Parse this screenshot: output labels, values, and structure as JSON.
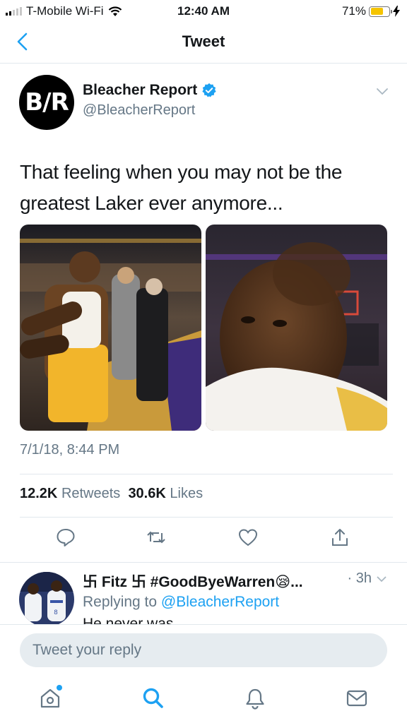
{
  "status_bar": {
    "carrier": "T-Mobile Wi-Fi",
    "time": "12:40 AM",
    "battery_percent": "71%",
    "battery_level": 0.71,
    "battery_color": "#f5c400"
  },
  "nav": {
    "title": "Tweet",
    "back_icon": "chevron-left-icon"
  },
  "tweet": {
    "avatar_text": "B/R",
    "author_name": "Bleacher Report",
    "verified": true,
    "author_handle": "@BleacherReport",
    "text": "That feeling when you may not be the greatest Laker ever anymore...",
    "timestamp": "7/1/18, 8:44 PM",
    "retweets_count": "12.2K",
    "retweets_label": "Retweets",
    "likes_count": "30.6K",
    "likes_label": "Likes",
    "photos": [
      {
        "icon": "photo-basketball-player-towel-courtside"
      },
      {
        "icon": "photo-basketball-player-closeup-towel"
      }
    ]
  },
  "actions": [
    {
      "name": "reply",
      "icon": "comment-icon"
    },
    {
      "name": "retweet",
      "icon": "retweet-icon"
    },
    {
      "name": "like",
      "icon": "heart-icon"
    },
    {
      "name": "share",
      "icon": "share-icon"
    }
  ],
  "reply": {
    "name": "卐 Fitz 卐 #GoodByeWarren😪...",
    "time": "· 3h",
    "replying_prefix": "Replying to",
    "replying_to": "@BleacherReport",
    "text": "He never was"
  },
  "compose": {
    "placeholder": "Tweet your reply"
  },
  "tabs": [
    {
      "name": "home",
      "icon": "home-icon",
      "has_dot": true
    },
    {
      "name": "search",
      "icon": "search-icon",
      "active": true
    },
    {
      "name": "notifications",
      "icon": "bell-icon"
    },
    {
      "name": "messages",
      "icon": "mail-icon"
    }
  ],
  "colors": {
    "accent": "#1da1f2",
    "text": "#14171a",
    "secondary": "#657786",
    "divider": "#e1e8ed"
  }
}
